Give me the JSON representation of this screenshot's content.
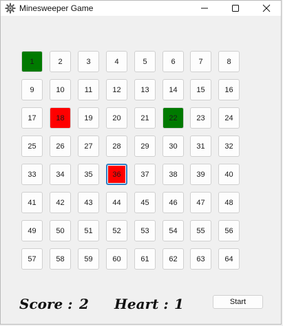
{
  "window": {
    "title": "Minesweeper Game",
    "icon": "mine-gear-icon",
    "controls": {
      "minimize": "minimize-icon",
      "maximize": "maximize-icon",
      "close": "close-icon"
    }
  },
  "board": {
    "columns": 8,
    "rows": 8,
    "cells": [
      {
        "label": "1",
        "state": "green"
      },
      {
        "label": "2",
        "state": "normal"
      },
      {
        "label": "3",
        "state": "normal"
      },
      {
        "label": "4",
        "state": "normal"
      },
      {
        "label": "5",
        "state": "normal"
      },
      {
        "label": "6",
        "state": "normal"
      },
      {
        "label": "7",
        "state": "normal"
      },
      {
        "label": "8",
        "state": "normal"
      },
      {
        "label": "9",
        "state": "normal"
      },
      {
        "label": "10",
        "state": "normal"
      },
      {
        "label": "11",
        "state": "normal"
      },
      {
        "label": "12",
        "state": "normal"
      },
      {
        "label": "13",
        "state": "normal"
      },
      {
        "label": "14",
        "state": "normal"
      },
      {
        "label": "15",
        "state": "normal"
      },
      {
        "label": "16",
        "state": "normal"
      },
      {
        "label": "17",
        "state": "normal"
      },
      {
        "label": "18",
        "state": "red"
      },
      {
        "label": "19",
        "state": "normal"
      },
      {
        "label": "20",
        "state": "normal"
      },
      {
        "label": "21",
        "state": "normal"
      },
      {
        "label": "22",
        "state": "green"
      },
      {
        "label": "23",
        "state": "normal"
      },
      {
        "label": "24",
        "state": "normal"
      },
      {
        "label": "25",
        "state": "normal"
      },
      {
        "label": "26",
        "state": "normal"
      },
      {
        "label": "27",
        "state": "normal"
      },
      {
        "label": "28",
        "state": "normal"
      },
      {
        "label": "29",
        "state": "normal"
      },
      {
        "label": "30",
        "state": "normal"
      },
      {
        "label": "31",
        "state": "normal"
      },
      {
        "label": "32",
        "state": "normal"
      },
      {
        "label": "33",
        "state": "normal"
      },
      {
        "label": "34",
        "state": "normal"
      },
      {
        "label": "35",
        "state": "normal"
      },
      {
        "label": "36",
        "state": "red",
        "focused": true
      },
      {
        "label": "37",
        "state": "normal"
      },
      {
        "label": "38",
        "state": "normal"
      },
      {
        "label": "39",
        "state": "normal"
      },
      {
        "label": "40",
        "state": "normal"
      },
      {
        "label": "41",
        "state": "normal"
      },
      {
        "label": "42",
        "state": "normal"
      },
      {
        "label": "43",
        "state": "normal"
      },
      {
        "label": "44",
        "state": "normal"
      },
      {
        "label": "45",
        "state": "normal"
      },
      {
        "label": "46",
        "state": "normal"
      },
      {
        "label": "47",
        "state": "normal"
      },
      {
        "label": "48",
        "state": "normal"
      },
      {
        "label": "49",
        "state": "normal"
      },
      {
        "label": "50",
        "state": "normal"
      },
      {
        "label": "51",
        "state": "normal"
      },
      {
        "label": "52",
        "state": "normal"
      },
      {
        "label": "53",
        "state": "normal"
      },
      {
        "label": "54",
        "state": "normal"
      },
      {
        "label": "55",
        "state": "normal"
      },
      {
        "label": "56",
        "state": "normal"
      },
      {
        "label": "57",
        "state": "normal"
      },
      {
        "label": "58",
        "state": "normal"
      },
      {
        "label": "59",
        "state": "normal"
      },
      {
        "label": "60",
        "state": "normal"
      },
      {
        "label": "61",
        "state": "normal"
      },
      {
        "label": "62",
        "state": "normal"
      },
      {
        "label": "63",
        "state": "normal"
      },
      {
        "label": "64",
        "state": "normal"
      }
    ]
  },
  "status": {
    "score_label": "Score :",
    "score_value": "2",
    "heart_label": "Heart :",
    "heart_value": "1"
  },
  "controls": {
    "start_label": "Start"
  },
  "colors": {
    "safe_green": "#007a00",
    "mine_red": "#ff0000",
    "focus_blue": "#2f7fc4"
  }
}
